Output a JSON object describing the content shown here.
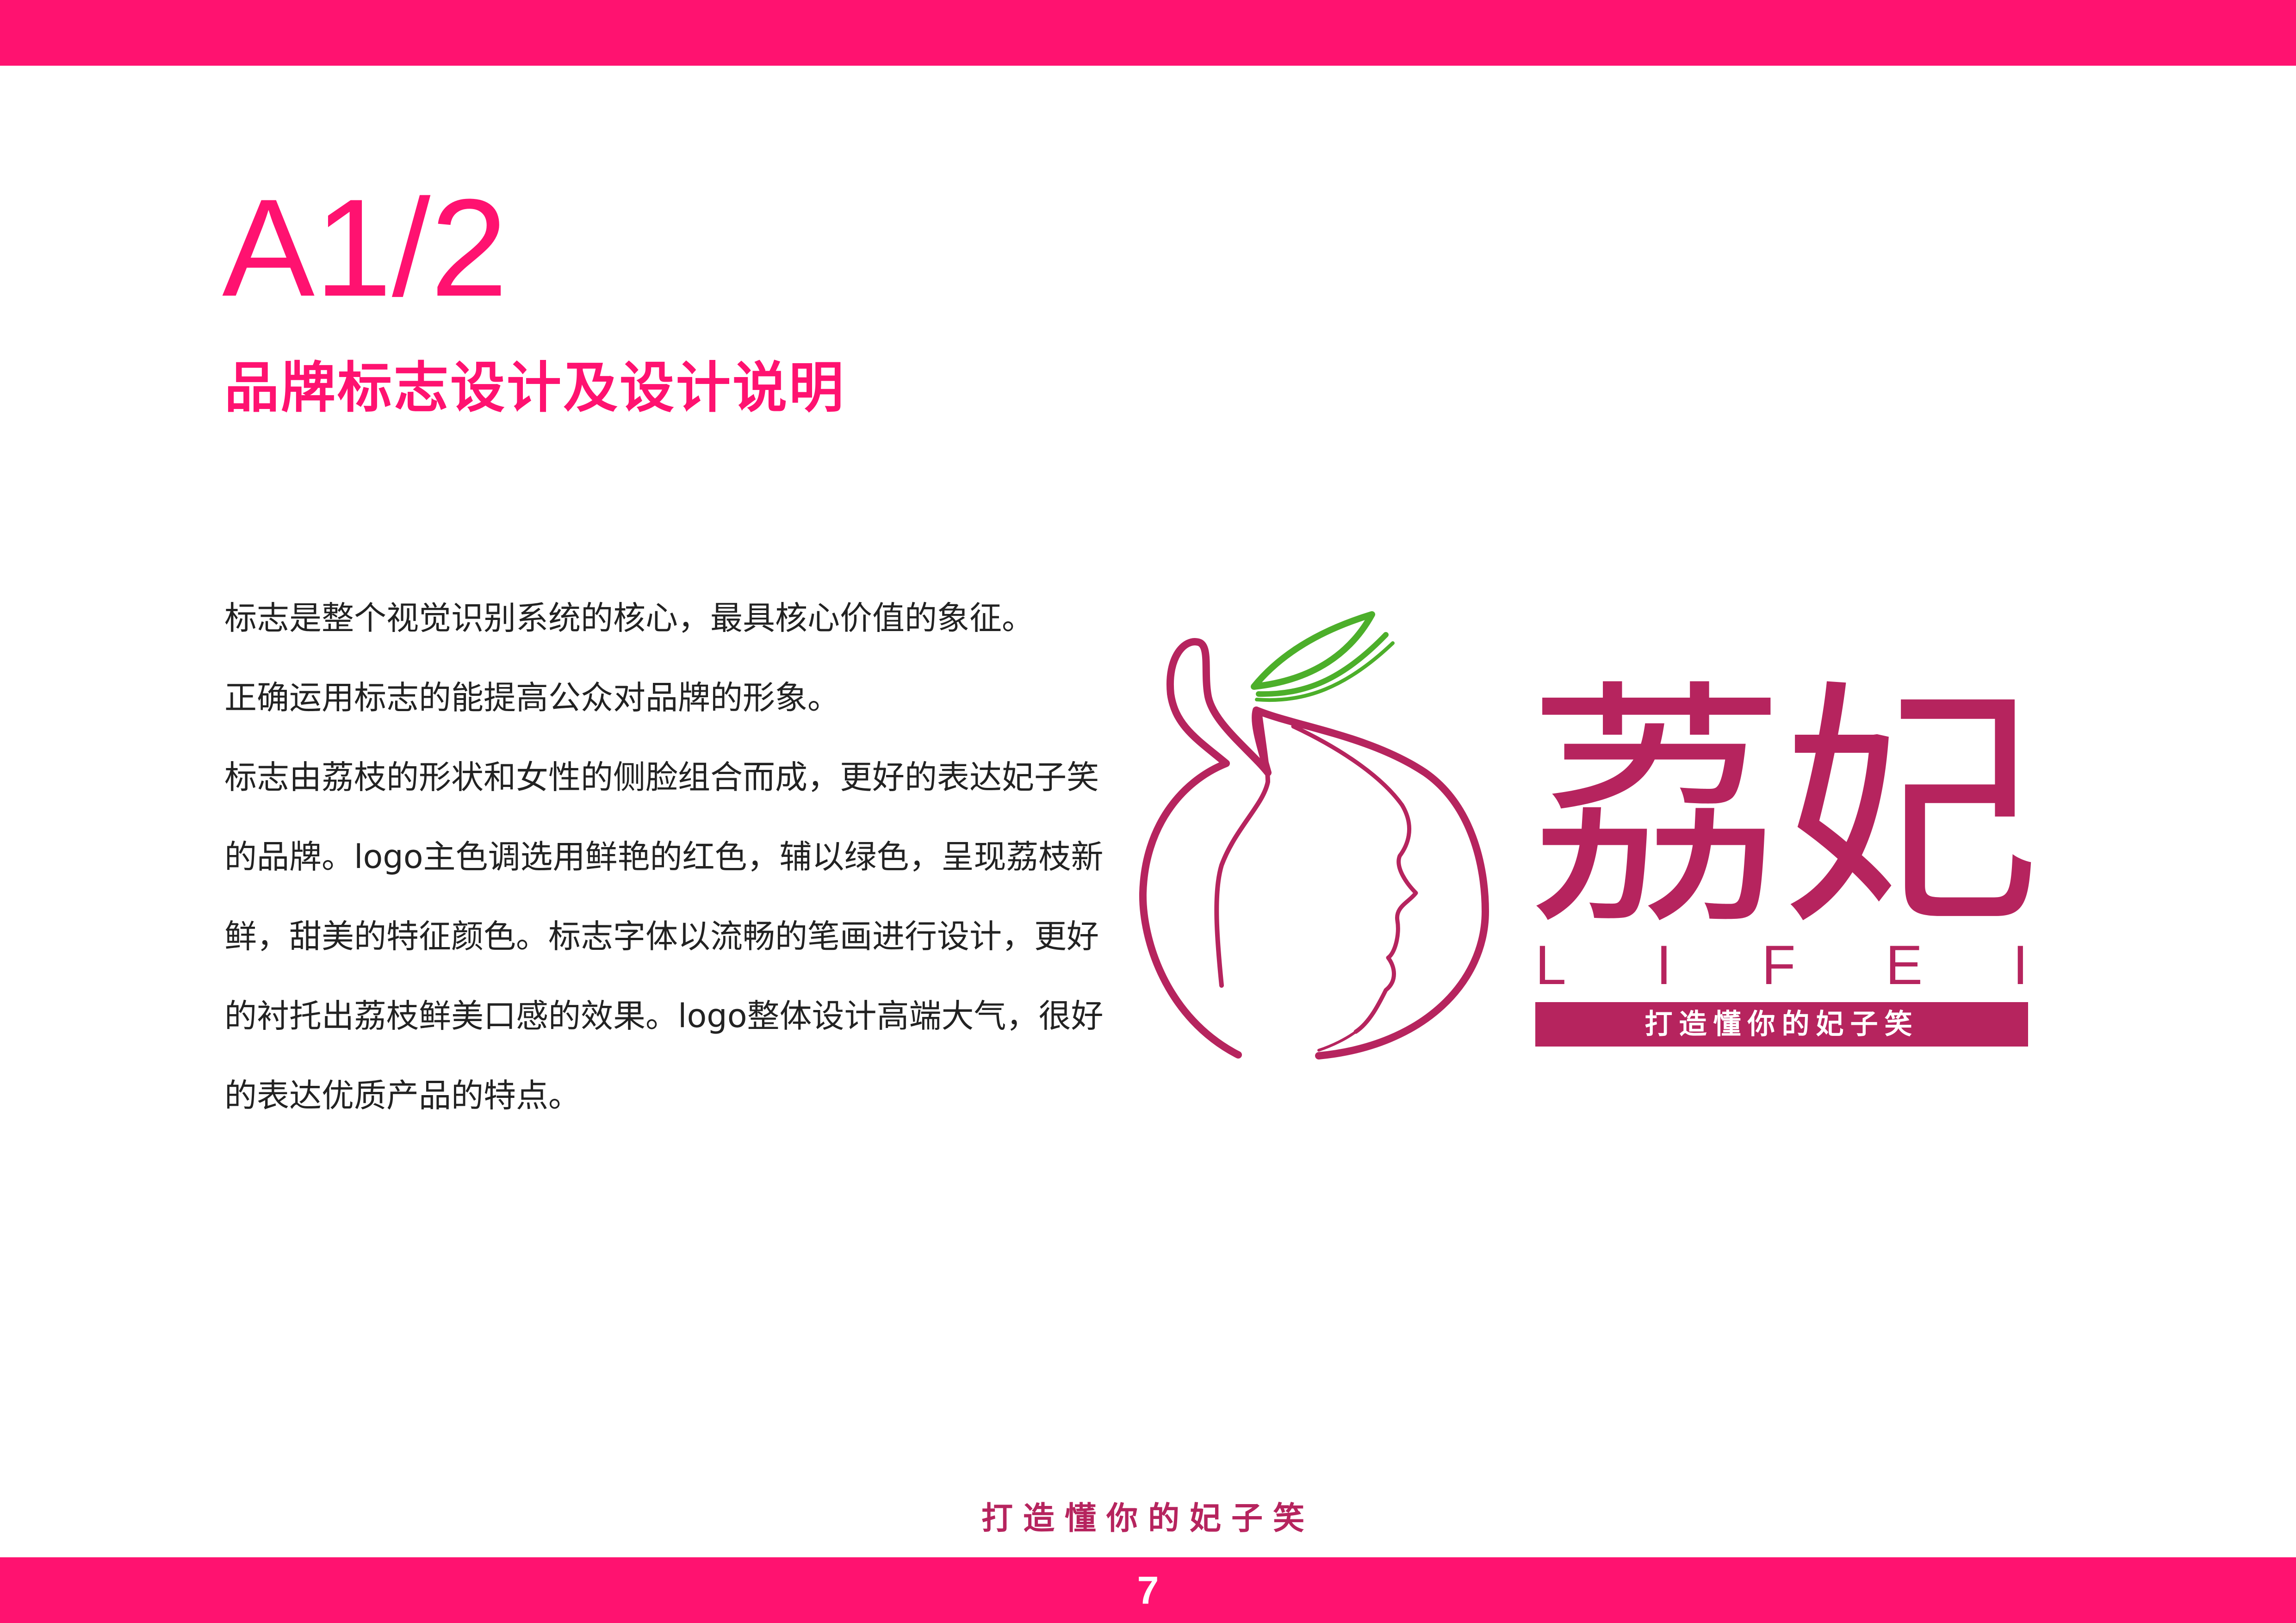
{
  "page": {
    "section_code": "A1/2",
    "section_title": "品牌标志设计及设计说明",
    "page_number": "7",
    "footer_slogan": "打造懂你的妃子笑"
  },
  "description": {
    "lines": [
      "标志是整个视觉识别系统的核心，最具核心价值的象征。",
      "正确运用标志的能提高公众对品牌的形象。",
      "标志由荔枝的形状和女性的侧脸组合而成，更好的表达妃子笑",
      "的品牌。logo主色调选用鲜艳的红色，辅以绿色，呈现荔枝新",
      "鲜，甜美的特征颜色。标志字体以流畅的笔画进行设计，更好",
      "的衬托出荔枝鲜美口感的效果。logo整体设计高端大气，很好",
      "的表达优质产品的特点。"
    ]
  },
  "logo": {
    "chinese_name": "荔妃",
    "latin_letters": [
      "L",
      "I",
      "F",
      "E",
      "I"
    ],
    "tagline": "打造懂你的妃子笑",
    "icon": "lychee-face-leaf-icon"
  },
  "colors": {
    "accent_pink": "#ff1270",
    "brand_magenta": "#b6245e",
    "leaf_green": "#4caf2a",
    "body_text": "#222222"
  }
}
